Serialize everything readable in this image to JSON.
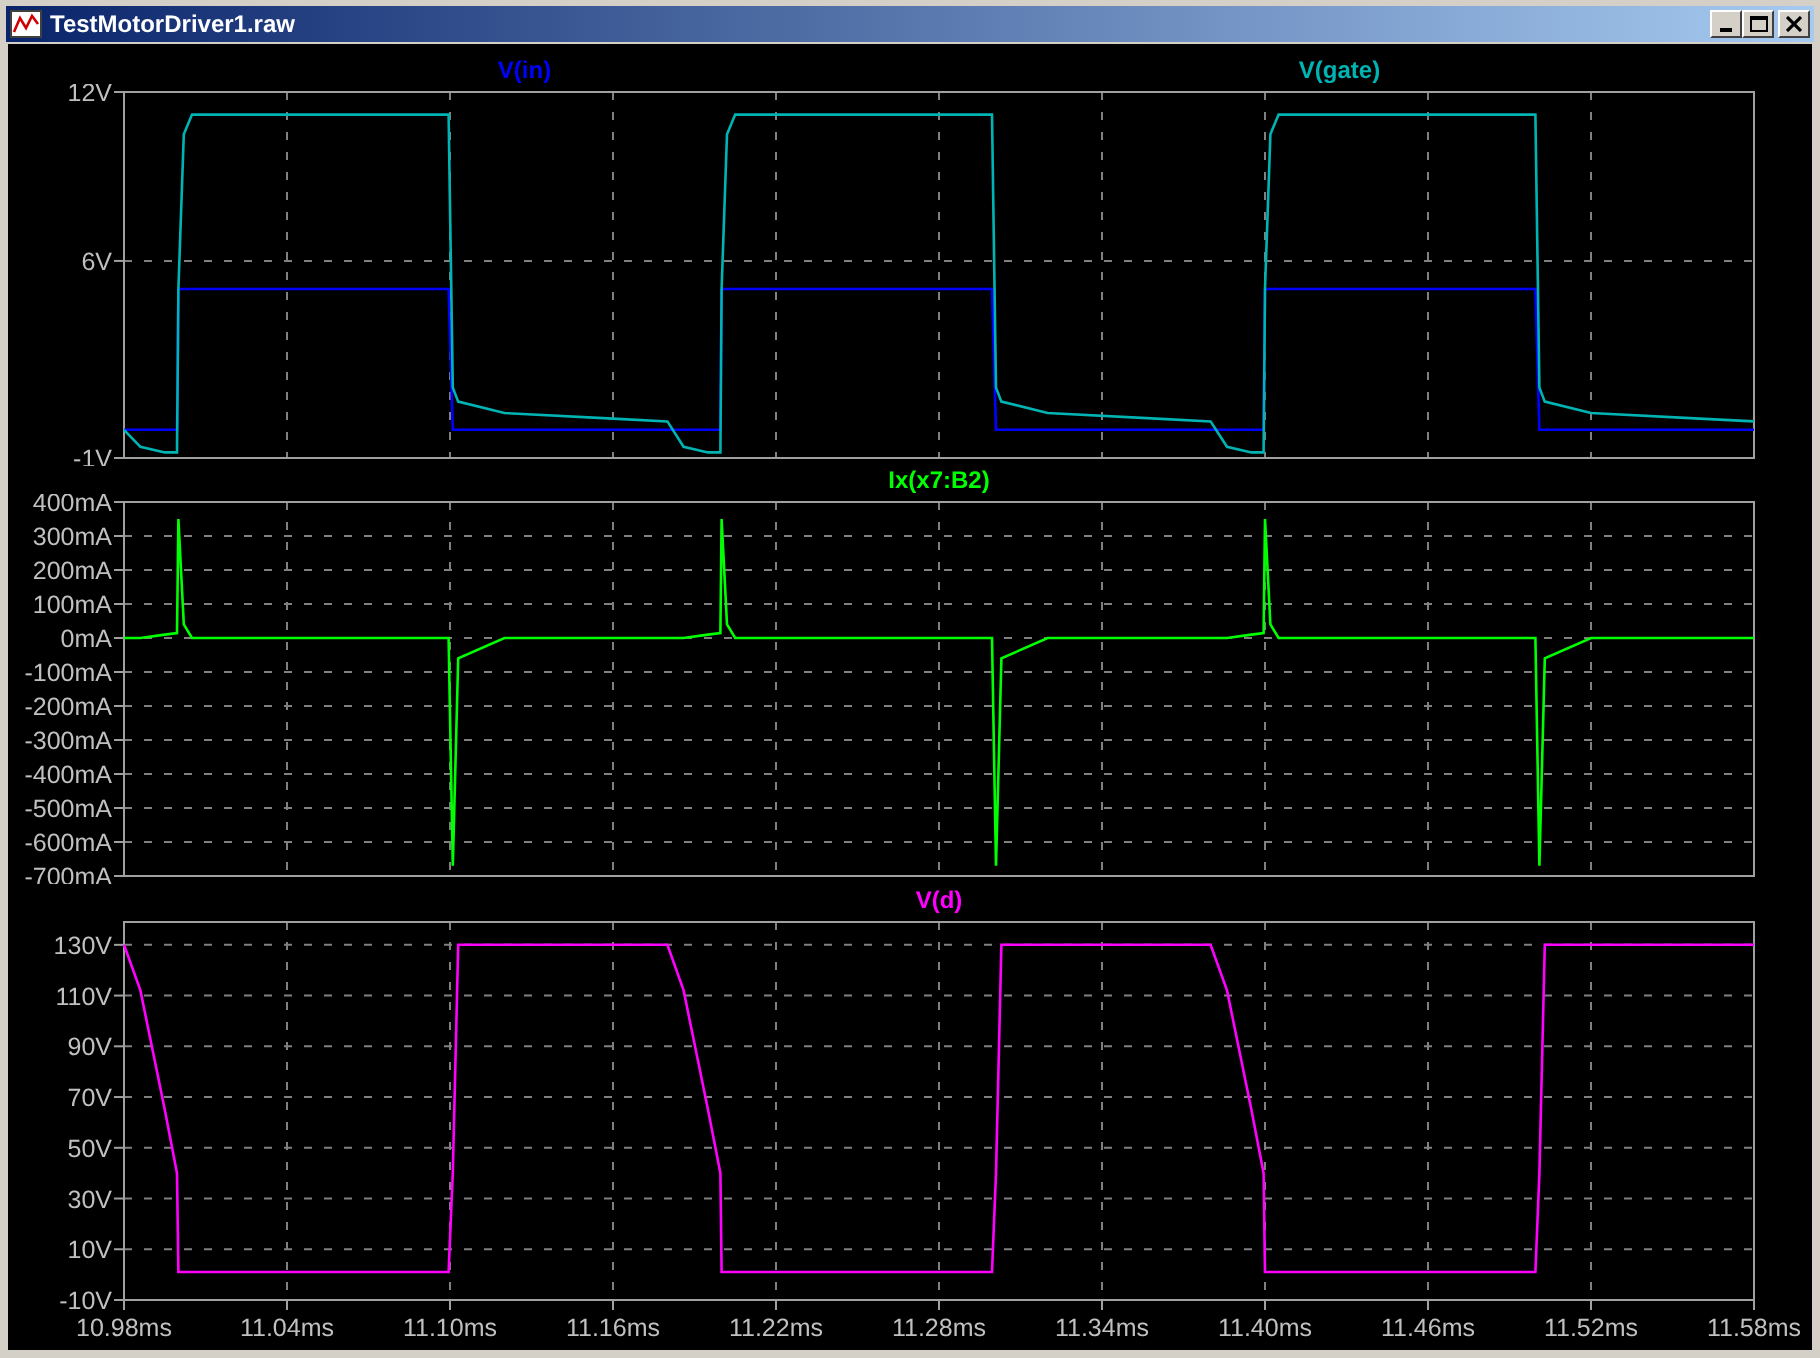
{
  "window": {
    "title": "TestMotorDriver1.raw"
  },
  "panels": [
    {
      "chart_data": {
        "type": "line",
        "xlim": [
          10.98,
          11.58
        ],
        "grid": true,
        "ylim": [
          -1,
          12
        ],
        "yticks": [
          {
            "value": -1,
            "label": "-1V"
          },
          {
            "value": 6,
            "label": "6V"
          },
          {
            "value": 12,
            "label": "12V"
          }
        ],
        "x": [
          10.98,
          10.986,
          10.995,
          10.9995,
          11.0,
          11.002,
          11.005,
          11.0995,
          11.101,
          11.103,
          11.12,
          11.16,
          11.18,
          11.186,
          11.195,
          11.1995,
          11.2,
          11.202,
          11.205,
          11.2995,
          11.301,
          11.303,
          11.32,
          11.36,
          11.38,
          11.386,
          11.395,
          11.3995,
          11.4,
          11.402,
          11.405,
          11.4995,
          11.501,
          11.503,
          11.52,
          11.56,
          11.58
        ],
        "series": [
          {
            "name": "V(in)",
            "color": "#0000ff",
            "values": [
              0,
              0,
              0,
              0,
              5,
              5,
              5,
              5,
              0,
              0,
              0,
              0,
              0,
              0,
              0,
              0,
              5,
              5,
              5,
              5,
              0,
              0,
              0,
              0,
              0,
              0,
              0,
              0,
              5,
              5,
              5,
              5,
              0,
              0,
              0,
              0,
              0
            ]
          },
          {
            "name": "V(gate)",
            "color": "#00b4b4",
            "values": [
              0,
              -0.6,
              -0.8,
              -0.8,
              5,
              10.5,
              11.2,
              11.2,
              1.5,
              1.0,
              0.6,
              0.4,
              0.3,
              -0.6,
              -0.8,
              -0.8,
              5,
              10.5,
              11.2,
              11.2,
              1.5,
              1.0,
              0.6,
              0.4,
              0.3,
              -0.6,
              -0.8,
              -0.8,
              5,
              10.5,
              11.2,
              11.2,
              1.5,
              1.0,
              0.6,
              0.4,
              0.3
            ]
          }
        ]
      }
    },
    {
      "chart_data": {
        "type": "line",
        "xlim": [
          10.98,
          11.58
        ],
        "grid": true,
        "ylim": [
          -700,
          400
        ],
        "yticks": [
          {
            "value": -700,
            "label": "-700mA"
          },
          {
            "value": -600,
            "label": "-600mA"
          },
          {
            "value": -500,
            "label": "-500mA"
          },
          {
            "value": -400,
            "label": "-400mA"
          },
          {
            "value": -300,
            "label": "-300mA"
          },
          {
            "value": -200,
            "label": "-200mA"
          },
          {
            "value": -100,
            "label": "-100mA"
          },
          {
            "value": 0,
            "label": "0mA"
          },
          {
            "value": 100,
            "label": "100mA"
          },
          {
            "value": 200,
            "label": "200mA"
          },
          {
            "value": 300,
            "label": "300mA"
          },
          {
            "value": 400,
            "label": "400mA"
          }
        ],
        "x": [
          10.98,
          10.986,
          10.995,
          10.9995,
          11.0,
          11.002,
          11.005,
          11.0995,
          11.101,
          11.103,
          11.12,
          11.16,
          11.18,
          11.186,
          11.195,
          11.1995,
          11.2,
          11.202,
          11.205,
          11.2995,
          11.301,
          11.303,
          11.32,
          11.36,
          11.38,
          11.386,
          11.395,
          11.3995,
          11.4,
          11.402,
          11.405,
          11.4995,
          11.501,
          11.503,
          11.52,
          11.56,
          11.58
        ],
        "series": [
          {
            "name": "Ix(x7:B2)",
            "color": "#00ff00",
            "values": [
              0,
              0,
              10,
              15,
              350,
              40,
              0,
              0,
              -670,
              -60,
              0,
              0,
              0,
              0,
              10,
              15,
              350,
              40,
              0,
              0,
              -670,
              -60,
              0,
              0,
              0,
              0,
              10,
              15,
              350,
              40,
              0,
              0,
              -670,
              -60,
              0,
              0,
              0
            ]
          }
        ]
      }
    },
    {
      "chart_data": {
        "type": "line",
        "xlim": [
          10.98,
          11.58
        ],
        "grid": true,
        "ylim": [
          -10,
          139
        ],
        "yticks": [
          {
            "value": -10,
            "label": "-10V"
          },
          {
            "value": 10,
            "label": "10V"
          },
          {
            "value": 30,
            "label": "30V"
          },
          {
            "value": 50,
            "label": "50V"
          },
          {
            "value": 70,
            "label": "70V"
          },
          {
            "value": 90,
            "label": "90V"
          },
          {
            "value": 110,
            "label": "110V"
          },
          {
            "value": 130,
            "label": "130V"
          }
        ],
        "xticks": [
          {
            "value": 10.98,
            "label": "10.98ms"
          },
          {
            "value": 11.04,
            "label": "11.04ms"
          },
          {
            "value": 11.1,
            "label": "11.10ms"
          },
          {
            "value": 11.16,
            "label": "11.16ms"
          },
          {
            "value": 11.22,
            "label": "11.22ms"
          },
          {
            "value": 11.28,
            "label": "11.28ms"
          },
          {
            "value": 11.34,
            "label": "11.34ms"
          },
          {
            "value": 11.4,
            "label": "11.40ms"
          },
          {
            "value": 11.46,
            "label": "11.46ms"
          },
          {
            "value": 11.52,
            "label": "11.52ms"
          },
          {
            "value": 11.58,
            "label": "11.58ms"
          }
        ],
        "x": [
          10.98,
          10.986,
          10.995,
          10.9995,
          11.0,
          11.002,
          11.005,
          11.0995,
          11.101,
          11.103,
          11.12,
          11.16,
          11.18,
          11.186,
          11.195,
          11.1995,
          11.2,
          11.202,
          11.205,
          11.2995,
          11.301,
          11.303,
          11.32,
          11.36,
          11.38,
          11.386,
          11.395,
          11.3995,
          11.4,
          11.402,
          11.405,
          11.4995,
          11.501,
          11.503,
          11.52,
          11.56,
          11.58
        ],
        "series": [
          {
            "name": "V(d)",
            "color": "#ff00ff",
            "values": [
              130,
              112,
              65,
              40,
              1,
              1,
              1,
              1,
              40,
              130,
              130,
              130,
              130,
              112,
              65,
              40,
              1,
              1,
              1,
              1,
              40,
              130,
              130,
              130,
              130,
              112,
              65,
              40,
              1,
              1,
              1,
              1,
              40,
              130,
              130,
              130,
              130
            ]
          }
        ]
      }
    }
  ]
}
